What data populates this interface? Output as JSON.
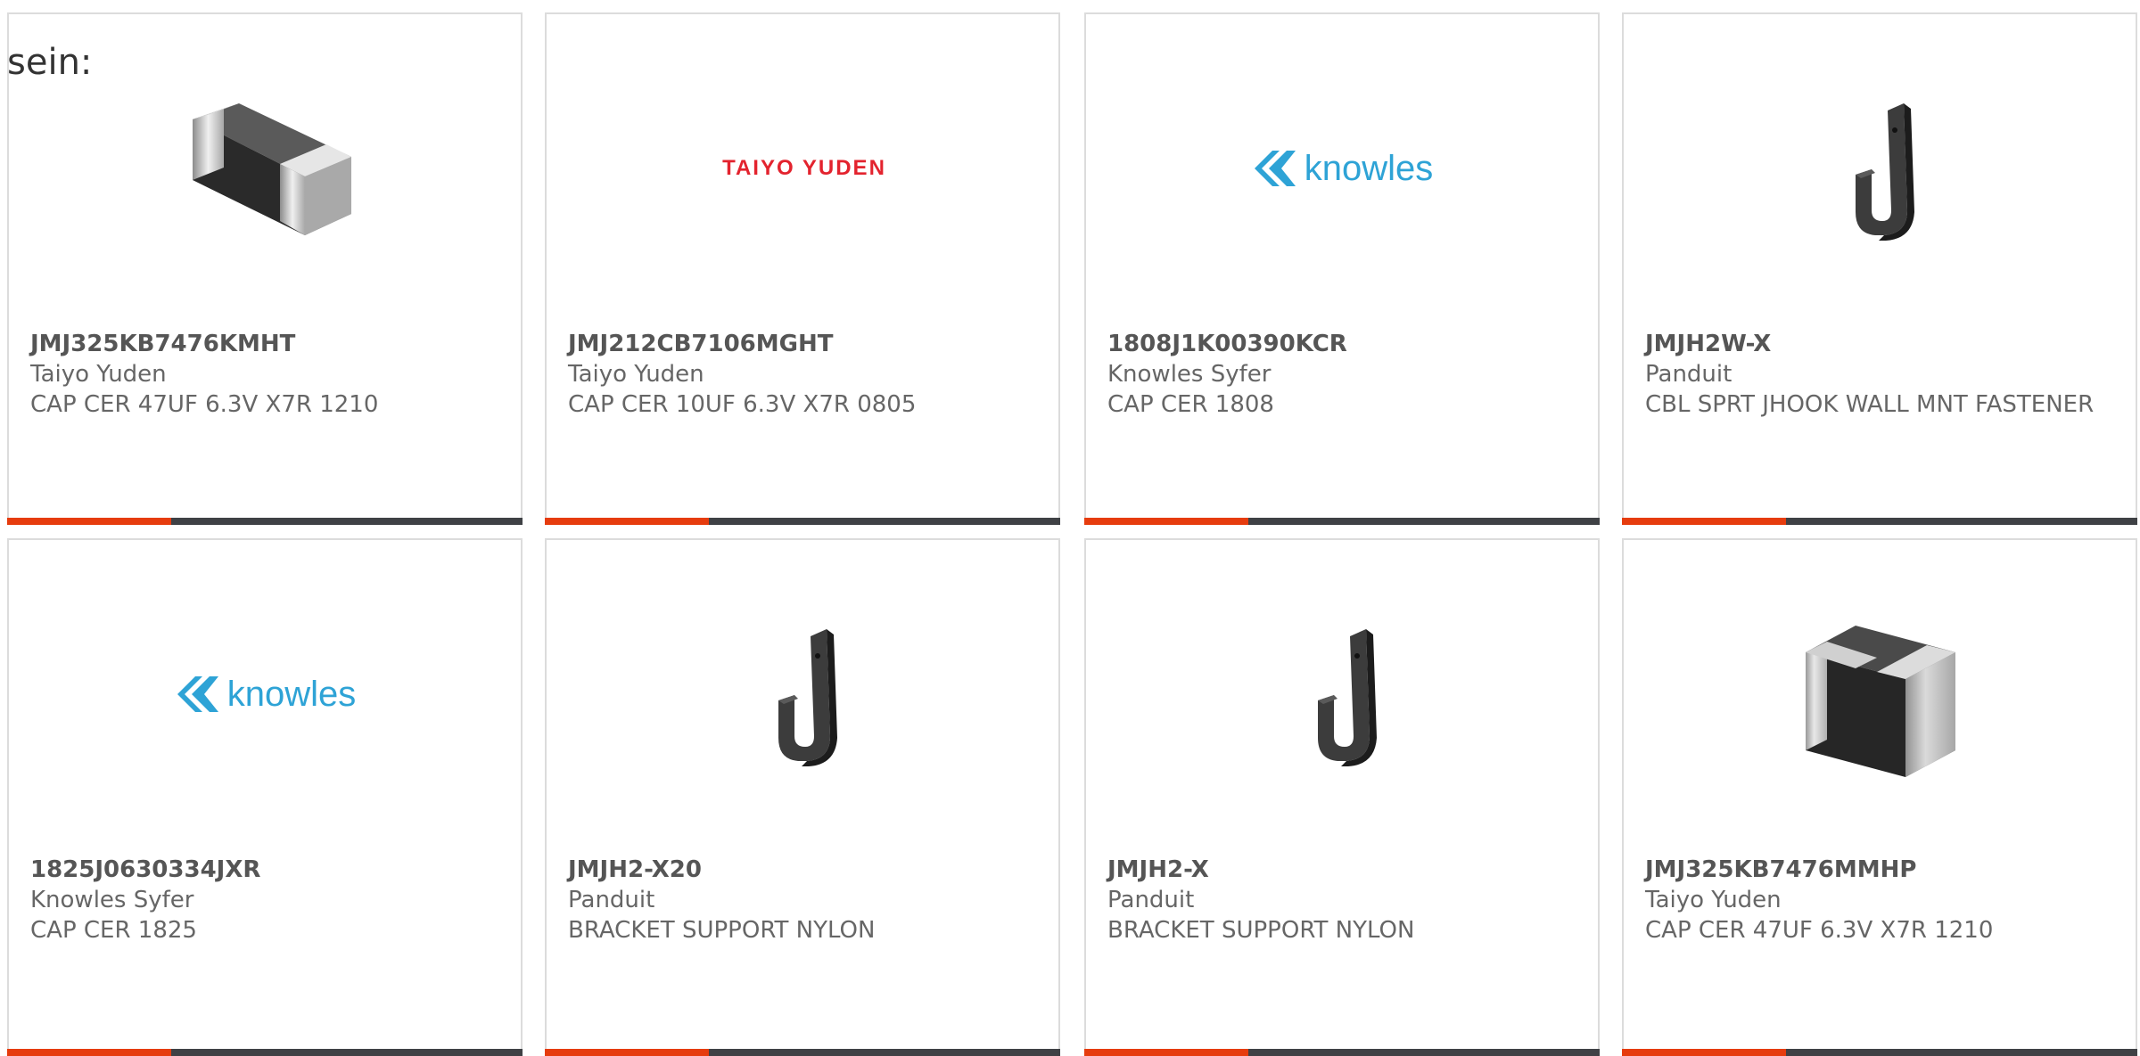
{
  "intro_text": "sein:",
  "colors": {
    "accent": "#e63c0e",
    "bar_dark": "#3f4145",
    "taiyo_red": "#e3232e",
    "knowles_blue": "#2ea3d6"
  },
  "cards": [
    {
      "part_number": "JMJ325KB7476KMHT",
      "manufacturer": "Taiyo Yuden",
      "description": "CAP CER 47UF 6.3V X7R 1210",
      "image": "chip-capacitor-image"
    },
    {
      "part_number": "JMJ212CB7106MGHT",
      "manufacturer": "Taiyo Yuden",
      "description": "CAP CER 10UF 6.3V X7R 0805",
      "image": "taiyo-yuden-logo",
      "logo_text": "TAIYO YUDEN"
    },
    {
      "part_number": "1808J1K00390KCR",
      "manufacturer": "Knowles Syfer",
      "description": "CAP CER 1808",
      "image": "knowles-logo",
      "logo_text": "knowles"
    },
    {
      "part_number": "JMJH2W-X",
      "manufacturer": "Panduit",
      "description": "CBL SPRT JHOOK WALL MNT FASTENER",
      "image": "j-hook-image"
    },
    {
      "part_number": "1825J0630334JXR",
      "manufacturer": "Knowles Syfer",
      "description": "CAP CER 1825",
      "image": "knowles-logo",
      "logo_text": "knowles"
    },
    {
      "part_number": "JMJH2-X20",
      "manufacturer": "Panduit",
      "description": "BRACKET SUPPORT NYLON",
      "image": "j-hook-image"
    },
    {
      "part_number": "JMJH2-X",
      "manufacturer": "Panduit",
      "description": "BRACKET SUPPORT NYLON",
      "image": "j-hook-image"
    },
    {
      "part_number": "JMJ325KB7476MMHP",
      "manufacturer": "Taiyo Yuden",
      "description": "CAP CER 47UF 6.3V X7R 1210",
      "image": "cube-capacitor-image"
    }
  ]
}
